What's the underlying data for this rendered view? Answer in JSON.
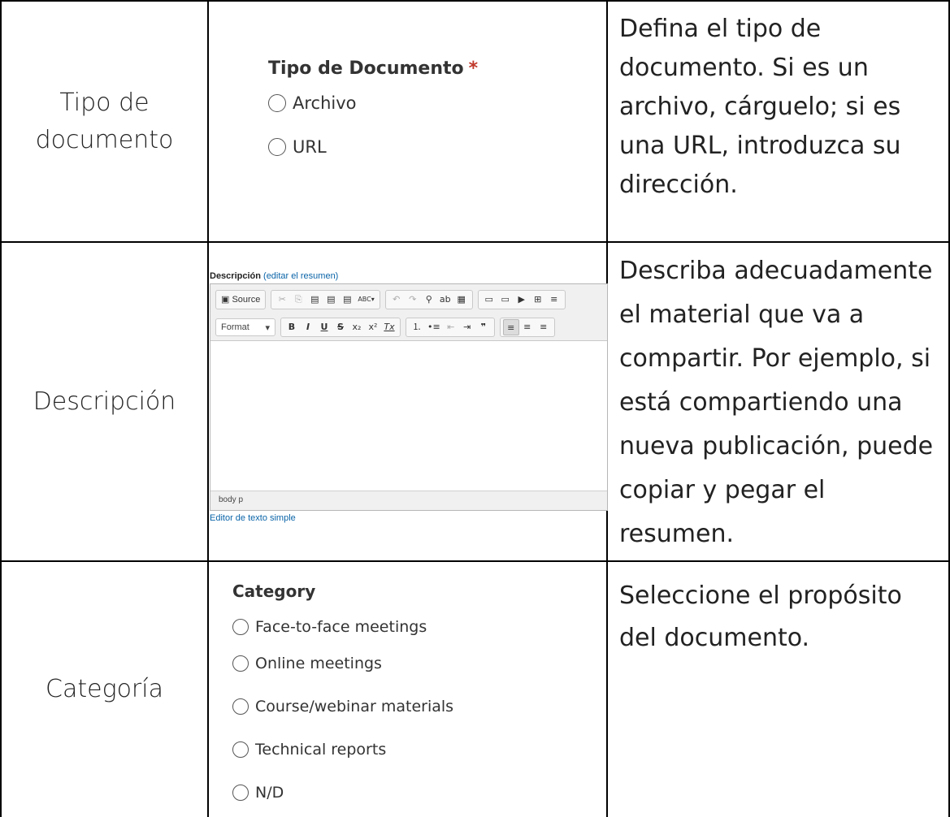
{
  "rows": [
    {
      "label_lines": [
        "Tipo de",
        "documento"
      ],
      "description_lines": [
        "Defina el tipo de",
        "documento. Si es un",
        "archivo, cárguelo; si es",
        "una URL, introduzca su",
        "dirección."
      ]
    },
    {
      "label_lines": [
        "Descripción"
      ],
      "description_lines": [
        "Describa adecuadamente",
        "el material que va a",
        "compartir. Por ejemplo, si",
        "está compartiendo una",
        "nueva publicación, puede",
        "copiar y pegar el",
        "resumen."
      ]
    },
    {
      "label_lines": [
        "Categoría"
      ],
      "description_lines": [
        "Seleccione el propósito",
        "del documento."
      ]
    }
  ],
  "tipo_form": {
    "title": "Tipo de Documento",
    "required_mark": "*",
    "options": [
      "Archivo",
      "URL"
    ]
  },
  "editor": {
    "label": "Descripción",
    "label_link": "(editar el resumen)",
    "source_button": "Source",
    "format_select": "Format",
    "toolbar_row1": [
      "✂",
      "⎘",
      "📋",
      "📋",
      "📋",
      "ABC",
      "↶",
      "↷",
      "🔍",
      "ab",
      "¶",
      "🖼",
      "🖼",
      "▶",
      "⊞",
      "≡"
    ],
    "toolbar_row2": [
      "B",
      "I",
      "U",
      "S",
      "x₂",
      "x²",
      "Ix",
      "≡",
      "≡",
      "⇤",
      "⇥",
      "99",
      "≡",
      "≡",
      "≡"
    ],
    "status_path": "body  p",
    "link_text": "Editor de texto simple"
  },
  "category_form": {
    "title": "Category",
    "options": [
      "Face-to-face meetings",
      "Online meetings",
      "Course/webinar materials",
      "Technical reports",
      "N/D"
    ]
  }
}
